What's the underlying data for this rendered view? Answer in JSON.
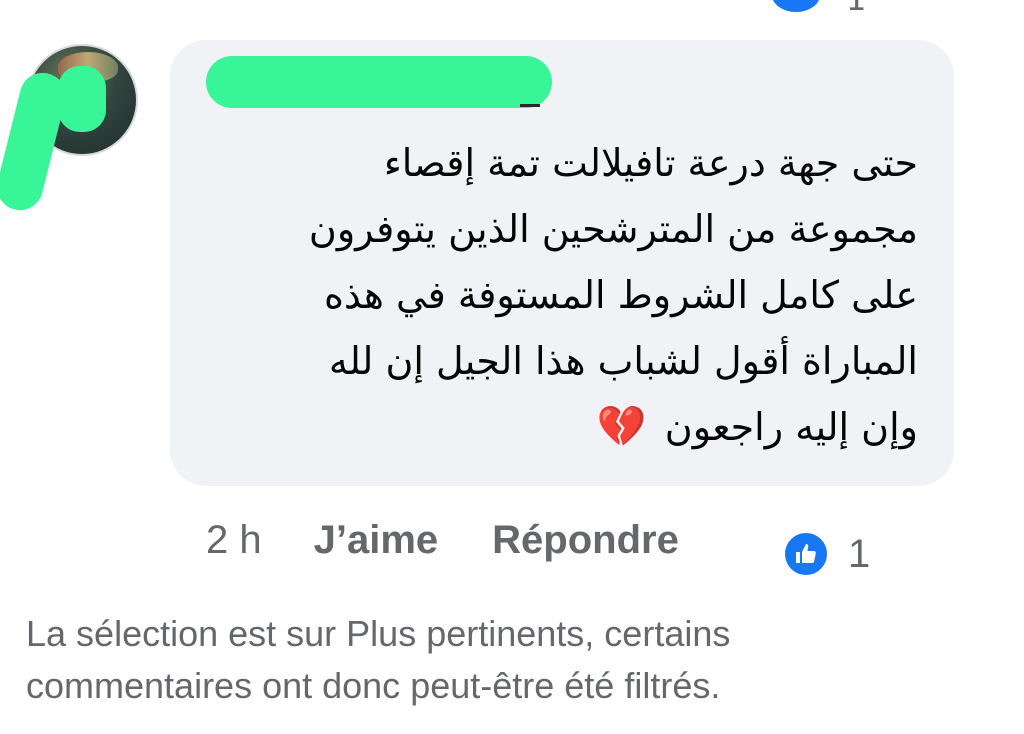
{
  "top": {
    "reaction_count": "1"
  },
  "comment": {
    "lines": [
      "حتى جهة درعة تافيلالت تمة إقصاء",
      "مجموعة من المترشحين الذين يتوفرون",
      "على كامل الشروط المستوفة في هذه",
      "المباراة أقول لشباب هذا الجيل إن لله",
      "وإن إليه راجعون"
    ],
    "emoji": "💔",
    "time": "2 h",
    "like_label": "J’aime",
    "reply_label": "Répondre",
    "reaction_count": "1"
  },
  "filter_note": "La sélection est sur Plus pertinents, certains commentaires ont donc peut-être été filtrés.",
  "colors": {
    "bubble": "#f0f2f5",
    "redaction": "#38f598",
    "like_blue": "#1877f2",
    "meta_text": "#65676b"
  },
  "icons": {
    "reaction": "thumbs-up-icon",
    "emoji": "broken-heart-icon"
  }
}
